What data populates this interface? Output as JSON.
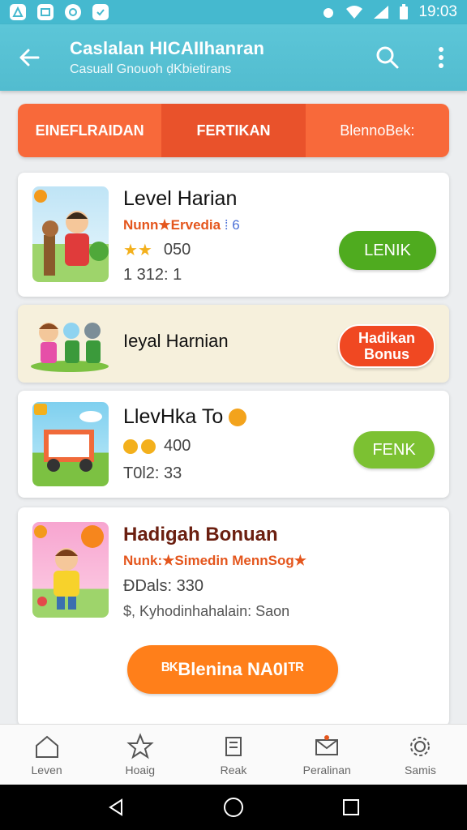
{
  "status_bar": {
    "time": "19:03"
  },
  "app_bar": {
    "title": "Caslalan HICAIIhanran",
    "subtitle": "Casuall Gnouoh  ḍKbietirans"
  },
  "tabs": [
    {
      "label": "EINEFLRAIDAN"
    },
    {
      "label": "FERTIKAN"
    },
    {
      "label": "BlennoBek:"
    }
  ],
  "cards": [
    {
      "title": "Level Harian",
      "meta": "Nunn★Ervedia",
      "meta_suffix": "⁞ 6",
      "stars": "★★",
      "score": "050",
      "line": "1 312: 1",
      "button": "LENIK",
      "button_color": "#4fab1f"
    },
    {
      "title": "Ieyal Harnian",
      "button": "Hadikan Bonus",
      "button_color": "#f04822"
    },
    {
      "title": "LlevHka To",
      "coins": "400",
      "line": "T0l2: 33",
      "button": "FENK",
      "button_color": "#7cc132"
    },
    {
      "title": "Hadigah Bonuan",
      "meta": "Nunk:★Simedin MennSog★",
      "line1": "ÐDals: 330",
      "line2": "$, Kyhodinhahalain: Saon",
      "button": "ᴮᴷBlenina NA0Iᵀᴿ",
      "button_color": "#ff7f1a"
    }
  ],
  "bottom_nav": [
    {
      "label": "Leven"
    },
    {
      "label": "Hoaig"
    },
    {
      "label": "Reak"
    },
    {
      "label": "Peralinan"
    },
    {
      "label": "Samis"
    }
  ]
}
